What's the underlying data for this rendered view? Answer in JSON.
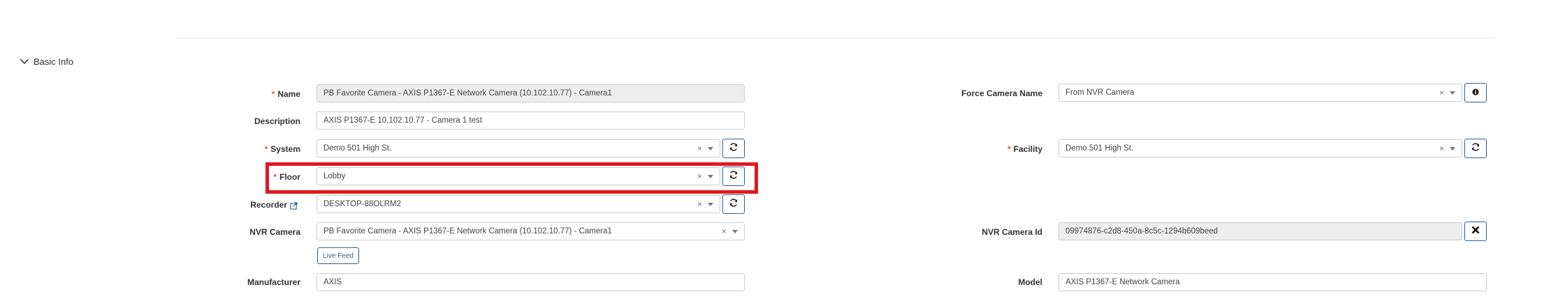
{
  "section": {
    "title": "Basic Info",
    "expanded": true
  },
  "left_fields": {
    "name": {
      "label": "Name",
      "required": true,
      "value": "PB Favorite Camera - AXIS P1367-E Network Camera (10.102.10.77) - Camera1"
    },
    "description": {
      "label": "Description",
      "value": "AXIS P1367-E 10.102.10.77 - Camera 1 test"
    },
    "system": {
      "label": "System",
      "required": true,
      "value": "Demo 501 High St.",
      "clear": "×"
    },
    "floor": {
      "label": "Floor",
      "required": true,
      "value": "Lobby",
      "clear": "×"
    },
    "recorder": {
      "label": "Recorder",
      "value": "DESKTOP-88OLRM2",
      "clear": "×"
    },
    "nvr_camera": {
      "label": "NVR Camera",
      "value": "PB Favorite Camera - AXIS P1367-E Network Camera (10.102.10.77) - Camera1",
      "clear": "×",
      "live_feed_label": "Live Feed"
    },
    "manufacturer": {
      "label": "Manufacturer",
      "value": "AXIS"
    }
  },
  "right_fields": {
    "force_camera_name": {
      "label": "Force Camera Name",
      "value": "From NVR Camera",
      "clear": "×"
    },
    "facility": {
      "label": "Facility",
      "required": true,
      "value": "Demo 501 High St.",
      "clear": "×"
    },
    "nvr_camera_id": {
      "label": "NVR Camera Id",
      "value": "09974876-c2d8-450a-8c5c-1294b609beed"
    },
    "model": {
      "label": "Model",
      "value": "AXIS P1367-E Network Camera"
    }
  },
  "required_marker": "*",
  "colors": {
    "accent": "#2f5f8a",
    "required": "#d9534f",
    "highlight": "#e0191f",
    "readonly_bg": "#eeeeee"
  },
  "icons": {
    "toggle": "chevron-down-icon",
    "refresh": "refresh-icon",
    "info": "info-icon",
    "clear_id": "close-icon",
    "external_link": "external-link-icon"
  }
}
